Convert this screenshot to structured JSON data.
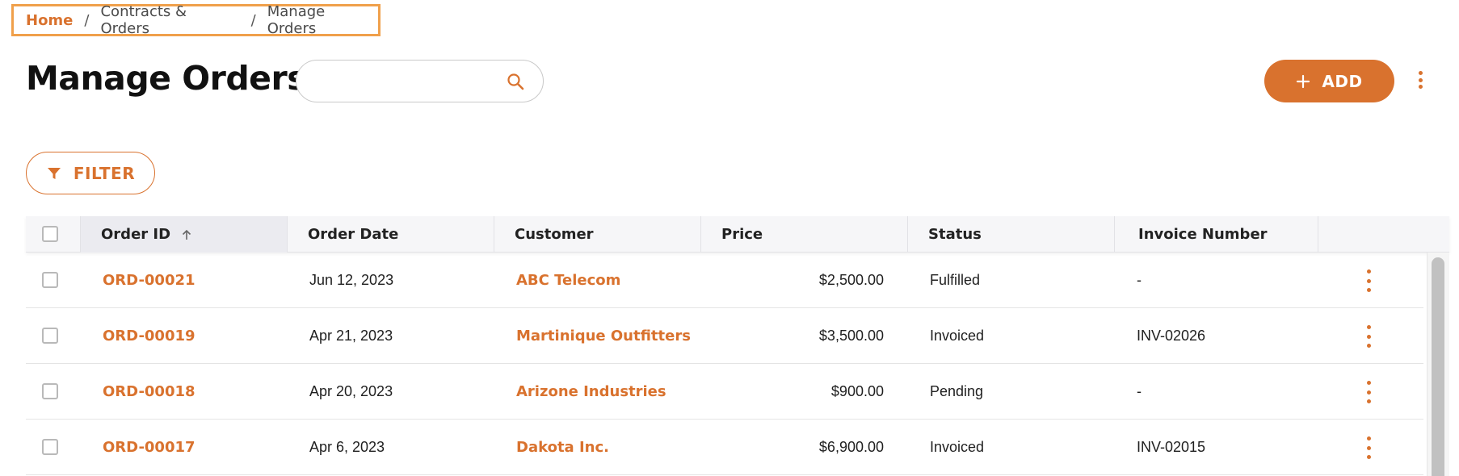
{
  "breadcrumb": {
    "home": "Home",
    "separator": "/",
    "section": "Contracts & Orders",
    "current": "Manage Orders"
  },
  "page_title": "Manage Orders",
  "search": {
    "value": "",
    "placeholder": "",
    "icon": "search-icon"
  },
  "add_button": {
    "label": "ADD",
    "icon": "plus-icon"
  },
  "filter_button": {
    "label": "FILTER",
    "icon": "filter-icon"
  },
  "colors": {
    "accent": "#d9722e",
    "highlight_border": "#f0a04b",
    "header_bg": "#f6f6f8"
  },
  "table": {
    "columns": {
      "order_id": "Order ID",
      "order_date": "Order Date",
      "customer": "Customer",
      "price": "Price",
      "status": "Status",
      "invoice_number": "Invoice Number"
    },
    "sort": {
      "column": "Order ID",
      "direction": "ascending"
    },
    "rows": [
      {
        "order_id": "ORD-00021",
        "order_date": "Jun 12, 2023",
        "customer": "ABC Telecom",
        "price": "$2,500.00",
        "status": "Fulfilled",
        "invoice_number": "-"
      },
      {
        "order_id": "ORD-00019",
        "order_date": "Apr 21, 2023",
        "customer": "Martinique Outfitters",
        "price": "$3,500.00",
        "status": "Invoiced",
        "invoice_number": "INV-02026"
      },
      {
        "order_id": "ORD-00018",
        "order_date": "Apr 20, 2023",
        "customer": "Arizone Industries",
        "price": "$900.00",
        "status": "Pending",
        "invoice_number": "-"
      },
      {
        "order_id": "ORD-00017",
        "order_date": "Apr 6, 2023",
        "customer": "Dakota Inc.",
        "price": "$6,900.00",
        "status": "Invoiced",
        "invoice_number": "INV-02015"
      }
    ]
  }
}
